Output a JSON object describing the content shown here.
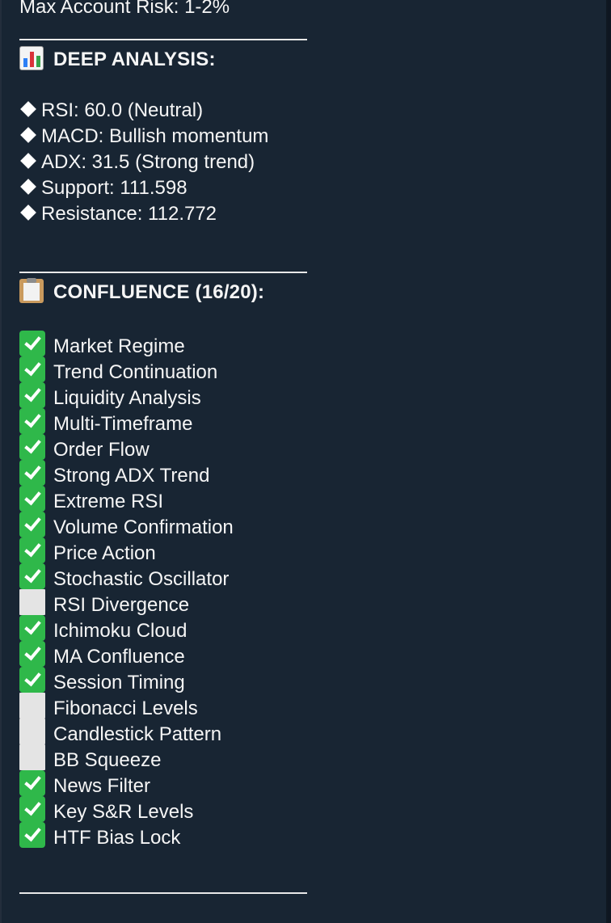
{
  "risk_line": "Max Account Risk: 1-2%",
  "analysis": {
    "heading": "DEEP ANALYSIS:",
    "icon": "bar-chart-icon",
    "items": [
      "RSI: 60.0 (Neutral)",
      "MACD: Bullish momentum",
      "ADX: 31.5 (Strong trend)",
      "Support: 111.598",
      "Resistance: 112.772"
    ]
  },
  "confluence": {
    "heading": "CONFLUENCE (16/20):",
    "icon": "clipboard-icon",
    "items": [
      {
        "label": "Market Regime",
        "checked": true
      },
      {
        "label": "Trend Continuation",
        "checked": true
      },
      {
        "label": "Liquidity Analysis",
        "checked": true
      },
      {
        "label": "Multi-Timeframe",
        "checked": true
      },
      {
        "label": "Order Flow",
        "checked": true
      },
      {
        "label": "Strong ADX Trend",
        "checked": true
      },
      {
        "label": "Extreme RSI",
        "checked": true
      },
      {
        "label": "Volume Confirmation",
        "checked": true
      },
      {
        "label": "Price Action",
        "checked": true
      },
      {
        "label": "Stochastic Oscillator",
        "checked": true
      },
      {
        "label": "RSI Divergence",
        "checked": false
      },
      {
        "label": "Ichimoku Cloud",
        "checked": true
      },
      {
        "label": "MA Confluence",
        "checked": true
      },
      {
        "label": "Session Timing",
        "checked": true
      },
      {
        "label": "Fibonacci Levels",
        "checked": false
      },
      {
        "label": "Candlestick Pattern",
        "checked": false
      },
      {
        "label": "BB Squeeze",
        "checked": false
      },
      {
        "label": "News Filter",
        "checked": true
      },
      {
        "label": "Key S&R Levels",
        "checked": true
      },
      {
        "label": "HTF Bias Lock",
        "checked": true
      }
    ]
  },
  "colors": {
    "background": "#0e1621",
    "bubble": "#182533",
    "text": "#f5f5f5",
    "check_green": "#2fb84a",
    "unchecked": "#e4e4e4"
  }
}
